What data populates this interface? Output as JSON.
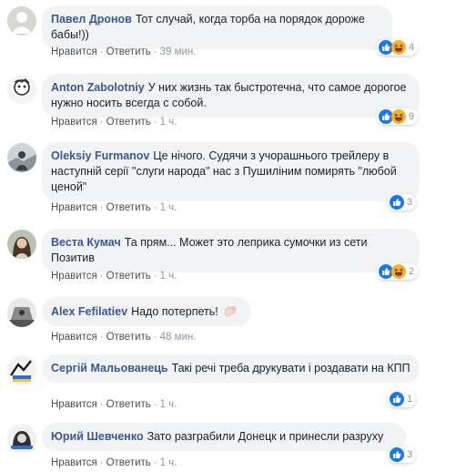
{
  "colors": {
    "name": "#385898",
    "bubble": "#f2f3f5",
    "meta": "#90949c",
    "like": "#1877f2",
    "haha": "#f7b125"
  },
  "comments": [
    {
      "author": "Павел Дронов",
      "text": "Тот случай, когда торба на порядок дороже бабы!))",
      "like": "Нравится",
      "reply": "Ответить",
      "time": "39 мин.",
      "reactions": {
        "icons": [
          "like-icon",
          "haha-icon"
        ],
        "count": "4"
      }
    },
    {
      "author": "Anton Zabolotniy",
      "text": "У них жизнь так быстротечна, что самое дорогое нужно носить всегда с собой.",
      "like": "Нравится",
      "reply": "Ответить",
      "time": "1 ч.",
      "reactions": {
        "icons": [
          "like-icon",
          "haha-icon"
        ],
        "count": "9"
      }
    },
    {
      "author": "Oleksiy Furmanov",
      "text": "Це нічого. Судячи з учорашнього трейлеру в наступній серії \"слуги народа\" нас з Пушиліним помирять \"любой ценой\"",
      "like": "Нравится",
      "reply": "Ответить",
      "time": "1 ч.",
      "reactions": {
        "icons": [
          "like-icon"
        ],
        "count": "3"
      }
    },
    {
      "author": "Веста Кумач",
      "text": "Та прям... Может это леприка сумочки из сети Позитив",
      "like": "Нравится",
      "reply": "Ответить",
      "time": "1 ч.",
      "reactions": {
        "icons": [
          "like-icon",
          "haha-icon"
        ],
        "count": "2"
      }
    },
    {
      "author": "Alex Fefilatiev",
      "text": "Надо потерпеть!",
      "emoji": "hand-icon",
      "like": "Нравится",
      "reply": "Ответить",
      "time": "48 мин."
    },
    {
      "author": "Сергій Мальованець",
      "text": "Такі речі треба друкувати і роздавати на КПП",
      "like": "Нравится",
      "reply": "Ответить",
      "time": "1 ч.",
      "reactions": {
        "icons": [
          "like-icon"
        ],
        "count": "1"
      }
    },
    {
      "author": "Юрий Шевченко",
      "text": "Зато разграбили Донецк и принесли разруху",
      "like": "Нравится",
      "reply": "Ответить",
      "time": "1 ч.",
      "reactions": {
        "icons": [
          "like-icon"
        ],
        "count": "3"
      }
    }
  ]
}
